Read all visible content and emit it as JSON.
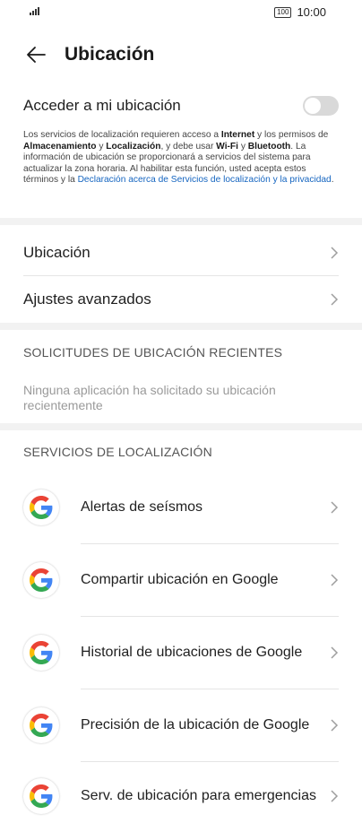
{
  "status": {
    "battery": "100",
    "time": "10:00"
  },
  "header": {
    "title": "Ubicación"
  },
  "location_toggle": {
    "label": "Acceder a mi ubicación",
    "enabled": false
  },
  "description": {
    "p1": "Los servicios de localización requieren acceso a ",
    "b1": "Internet",
    "p2": " y los permisos de ",
    "b2": "Almacenamiento",
    "p3": " y ",
    "b3": "Localización",
    "p4": ", y debe usar ",
    "b4": "Wi-Fi",
    "p5": " y ",
    "b5": "Bluetooth",
    "p6": ". La información de ubicación se proporcionará a servicios del sistema para actualizar la zona horaria. Al habilitar esta función, usted acepta estos términos y la ",
    "link": "Declaración acerca de Servicios de localización y la privacidad",
    "p7": "."
  },
  "menu": {
    "ubicacion": "Ubicación",
    "ajustes": "Ajustes avanzados"
  },
  "recent": {
    "header": "SOLICITUDES DE UBICACIÓN RECIENTES",
    "empty": "Ninguna aplicación ha solicitado su ubicación recientemente"
  },
  "services": {
    "header": "SERVICIOS DE LOCALIZACIÓN",
    "items": [
      {
        "label": "Alertas de seísmos",
        "icon": "google-icon"
      },
      {
        "label": "Compartir ubicación en Google",
        "icon": "google-icon"
      },
      {
        "label": "Historial de ubicaciones de Google",
        "icon": "google-icon"
      },
      {
        "label": "Precisión de la ubicación de Google",
        "icon": "google-icon"
      },
      {
        "label": "Serv. de ubicación para emergencias",
        "icon": "google-icon"
      }
    ]
  }
}
